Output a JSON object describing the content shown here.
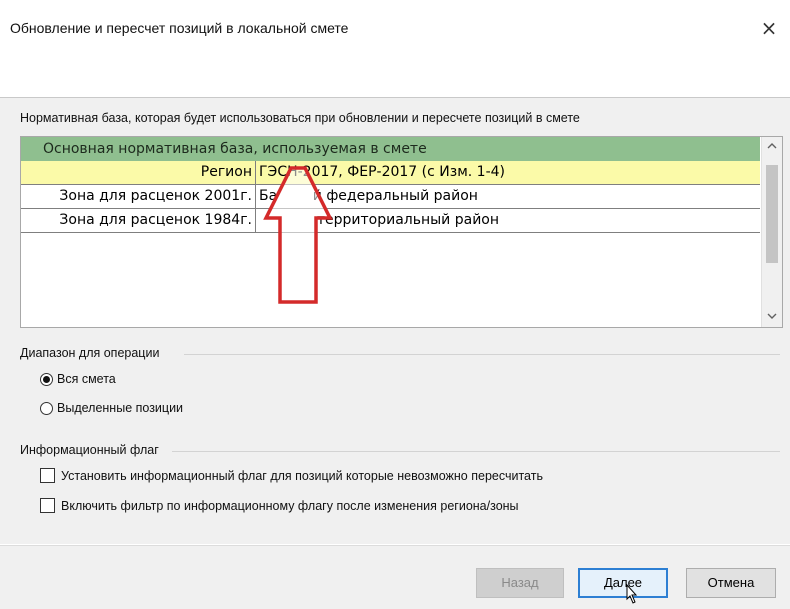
{
  "window": {
    "title": "Обновление и пересчет позиций в локальной смете",
    "close_symbol": "×"
  },
  "description": "Нормативная база, которая будет использоваться при обновлении и пересчете позиций в смете",
  "grid": {
    "header": "Основная нормативная база, используемая в смете",
    "rows": [
      {
        "label": "Регион",
        "value": "ГЭСН-2017, ФЕР-2017 (с Изм. 1-4)"
      },
      {
        "label": "Зона для расценок 2001г.",
        "value": "Ба        й федеральный район"
      },
      {
        "label": "Зона для расценок 1984г.",
        "value": "             территориальный район"
      }
    ],
    "scroll_up": "^",
    "scroll_down": "v"
  },
  "range_group": {
    "label": "Диапазон для операции",
    "options": [
      {
        "label": "Вся смета",
        "checked": true
      },
      {
        "label": "Выделенные позиции",
        "checked": false
      }
    ]
  },
  "flag_group": {
    "label": "Информационный флаг",
    "checkboxes": [
      {
        "label": "Установить информационный флаг для позиций которые невозможно пересчитать",
        "checked": false
      },
      {
        "label": "Включить фильтр по информационному флагу после изменения региона/зоны",
        "checked": false
      }
    ]
  },
  "buttons": {
    "back": "Назад",
    "next": "Далее",
    "cancel": "Отмена"
  },
  "colors": {
    "header_bg": "#8fbf8f",
    "selected_row_bg": "#fbfaa8",
    "annotation_arrow": "#d42a2a",
    "primary_button_border": "#2d7fd3"
  },
  "icons": {
    "close": "close-icon",
    "annotation": "red-arrow-annotation",
    "cursor": "mouse-pointer-icon"
  }
}
